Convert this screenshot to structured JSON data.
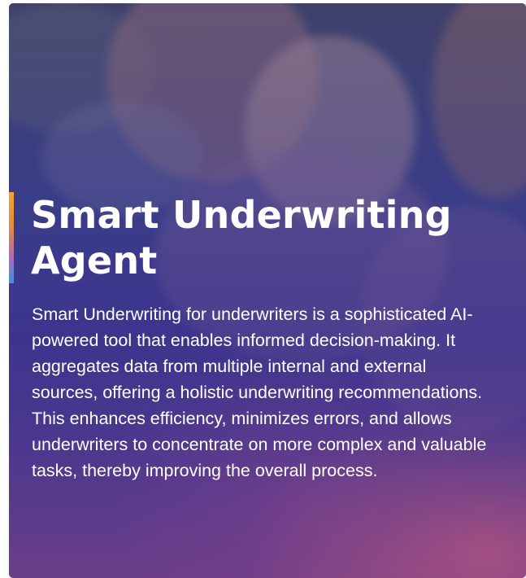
{
  "hero": {
    "title": "Smart Underwriting Agent",
    "description": "Smart Underwriting for underwriters is a sophisticated AI-powered tool that enables informed decision-making. It aggregates data from multiple internal and external sources, offering a holistic underwriting recommendations. This enhances efficiency, minimizes errors, and allows underwriters to concentrate on more complex and valuable tasks, thereby improving the overall process.",
    "image": "family-photo"
  },
  "colors": {
    "accent_top": "#f3a233",
    "accent_bottom": "#3c8fe6",
    "overlay_blue": "#3e378f",
    "overlay_pink": "#d66078",
    "text": "#ffffff"
  }
}
